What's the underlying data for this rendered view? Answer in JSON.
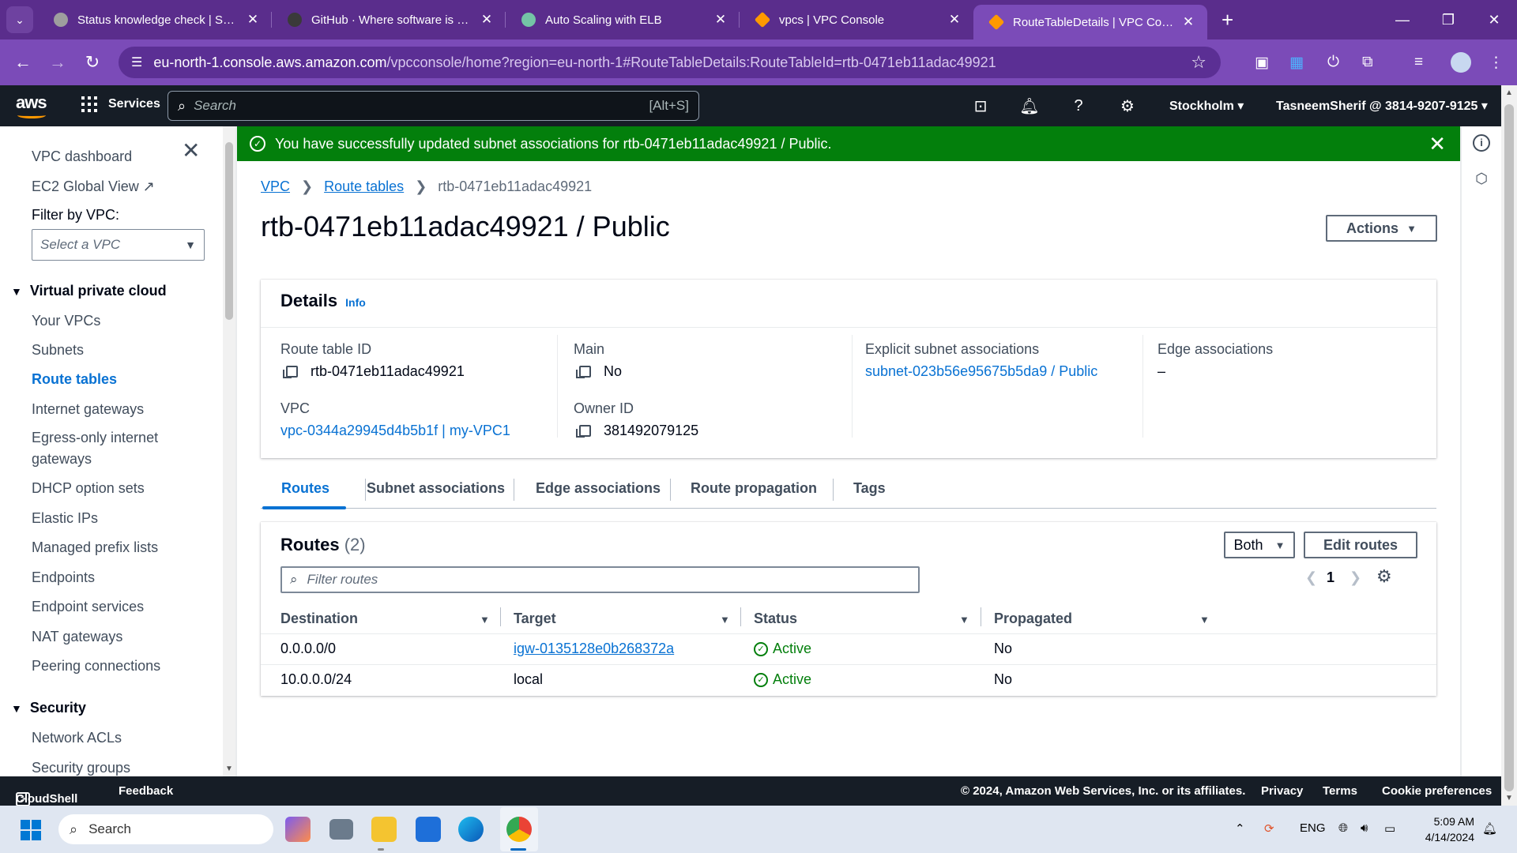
{
  "browser": {
    "tabs": [
      {
        "title": "Status knowledge check | Sprint",
        "color": "#9e9e9e"
      },
      {
        "title": "GitHub · Where software is built",
        "color": "#3a3a3a"
      },
      {
        "title": "Auto Scaling with ELB",
        "color": "#74c4a6"
      },
      {
        "title": "vpcs | VPC Console",
        "color": "#ff9900"
      },
      {
        "title": "RouteTableDetails | VPC Console",
        "color": "#ff9900"
      }
    ],
    "url_host": "eu-north-1.console.aws.amazon.com",
    "url_path": "/vpcconsole/home?region=eu-north-1#RouteTableDetails:RouteTableId=rtb-0471eb11adac49921"
  },
  "topnav": {
    "logo": "aws",
    "services": "Services",
    "search_placeholder": "Search",
    "search_shortcut": "[Alt+S]",
    "region": "Stockholm",
    "account": "TasneemSherif @ 3814-9207-9125"
  },
  "sidenav": {
    "top_items": [
      "VPC dashboard",
      "EC2 Global View"
    ],
    "filter_label": "Filter by VPC:",
    "filter_placeholder": "Select a VPC",
    "sections": [
      {
        "title": "Virtual private cloud",
        "items": [
          "Your VPCs",
          "Subnets",
          "Route tables",
          "Internet gateways",
          "Egress-only internet",
          "gateways",
          "DHCP option sets",
          "Elastic IPs",
          "Managed prefix lists",
          "Endpoints",
          "Endpoint services",
          "NAT gateways",
          "Peering connections"
        ]
      },
      {
        "title": "Security",
        "items": [
          "Network ACLs",
          "Security groups"
        ]
      }
    ]
  },
  "flash": {
    "message": "You have successfully updated subnet associations for rtb-0471eb11adac49921 / Public.",
    "color": "#037f0c"
  },
  "breadcrumb": {
    "root": "VPC",
    "parent": "Route tables",
    "current": "rtb-0471eb11adac49921"
  },
  "page": {
    "title": "rtb-0471eb11adac49921 / Public",
    "actions": "Actions"
  },
  "details": {
    "heading": "Details",
    "info": "Info",
    "route_table_id_label": "Route table ID",
    "route_table_id": "rtb-0471eb11adac49921",
    "main_label": "Main",
    "main": "No",
    "explicit_label": "Explicit subnet associations",
    "explicit": "subnet-023b56e95675b5da9 / Public",
    "edge_label": "Edge associations",
    "edge": "–",
    "vpc_label": "VPC",
    "vpc": "vpc-0344a29945d4b5b1f | my-VPC1",
    "owner_label": "Owner ID",
    "owner": "381492079125"
  },
  "tabs": [
    "Routes",
    "Subnet associations",
    "Edge associations",
    "Route propagation",
    "Tags"
  ],
  "routes": {
    "title": "Routes",
    "count": "(2)",
    "filter_select": "Both",
    "edit": "Edit routes",
    "filter_placeholder": "Filter routes",
    "page": "1",
    "columns": [
      "Destination",
      "Target",
      "Status",
      "Propagated"
    ],
    "rows": [
      {
        "destination": "0.0.0.0/0",
        "target": "igw-0135128e0b268372a",
        "status": "Active",
        "propagated": "No"
      },
      {
        "destination": "10.0.0.0/24",
        "target": "local",
        "status": "Active",
        "propagated": "No"
      }
    ]
  },
  "footer": {
    "cloudshell": "CloudShell",
    "feedback": "Feedback",
    "copyright": "© 2024, Amazon Web Services, Inc. or its affiliates.",
    "privacy": "Privacy",
    "terms": "Terms",
    "cookies": "Cookie preferences"
  },
  "taskbar": {
    "search": "Search",
    "lang": "ENG",
    "time": "5:09 AM",
    "date": "4/14/2024"
  }
}
